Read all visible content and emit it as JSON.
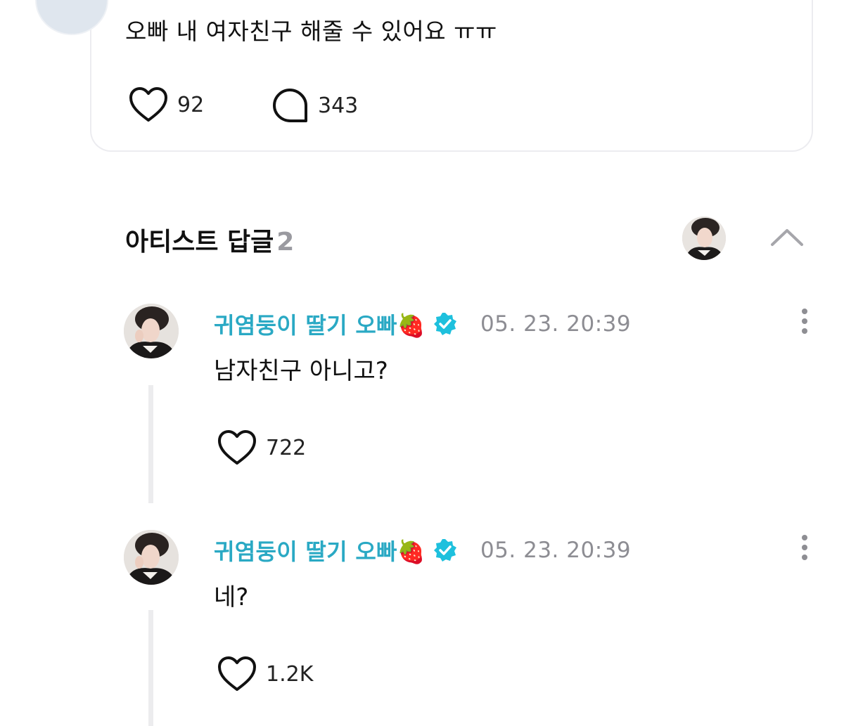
{
  "post": {
    "text": "오빠 내 여자친구 해줄 수 있어요 ㅠㅠ",
    "likes": "92",
    "comments": "343"
  },
  "section": {
    "title": "아티스트 답글",
    "count": "2"
  },
  "replies": [
    {
      "author": "귀염둥이 딸기 오빠🍓",
      "time": "05. 23. 20:39",
      "text": "남자친구 아니고?",
      "likes": "722"
    },
    {
      "author": "귀염둥이 딸기 오빠🍓",
      "time": "05. 23. 20:39",
      "text": "네?",
      "likes": "1.2K"
    }
  ],
  "colors": {
    "author": "#2aa9c4",
    "verified_badge": "#1ec0dd",
    "timestamp": "#8d8d93"
  },
  "icons": [
    "heart-icon",
    "comment-bubble-icon",
    "verified-badge-icon",
    "chevron-up-icon",
    "more-vertical-icon"
  ]
}
